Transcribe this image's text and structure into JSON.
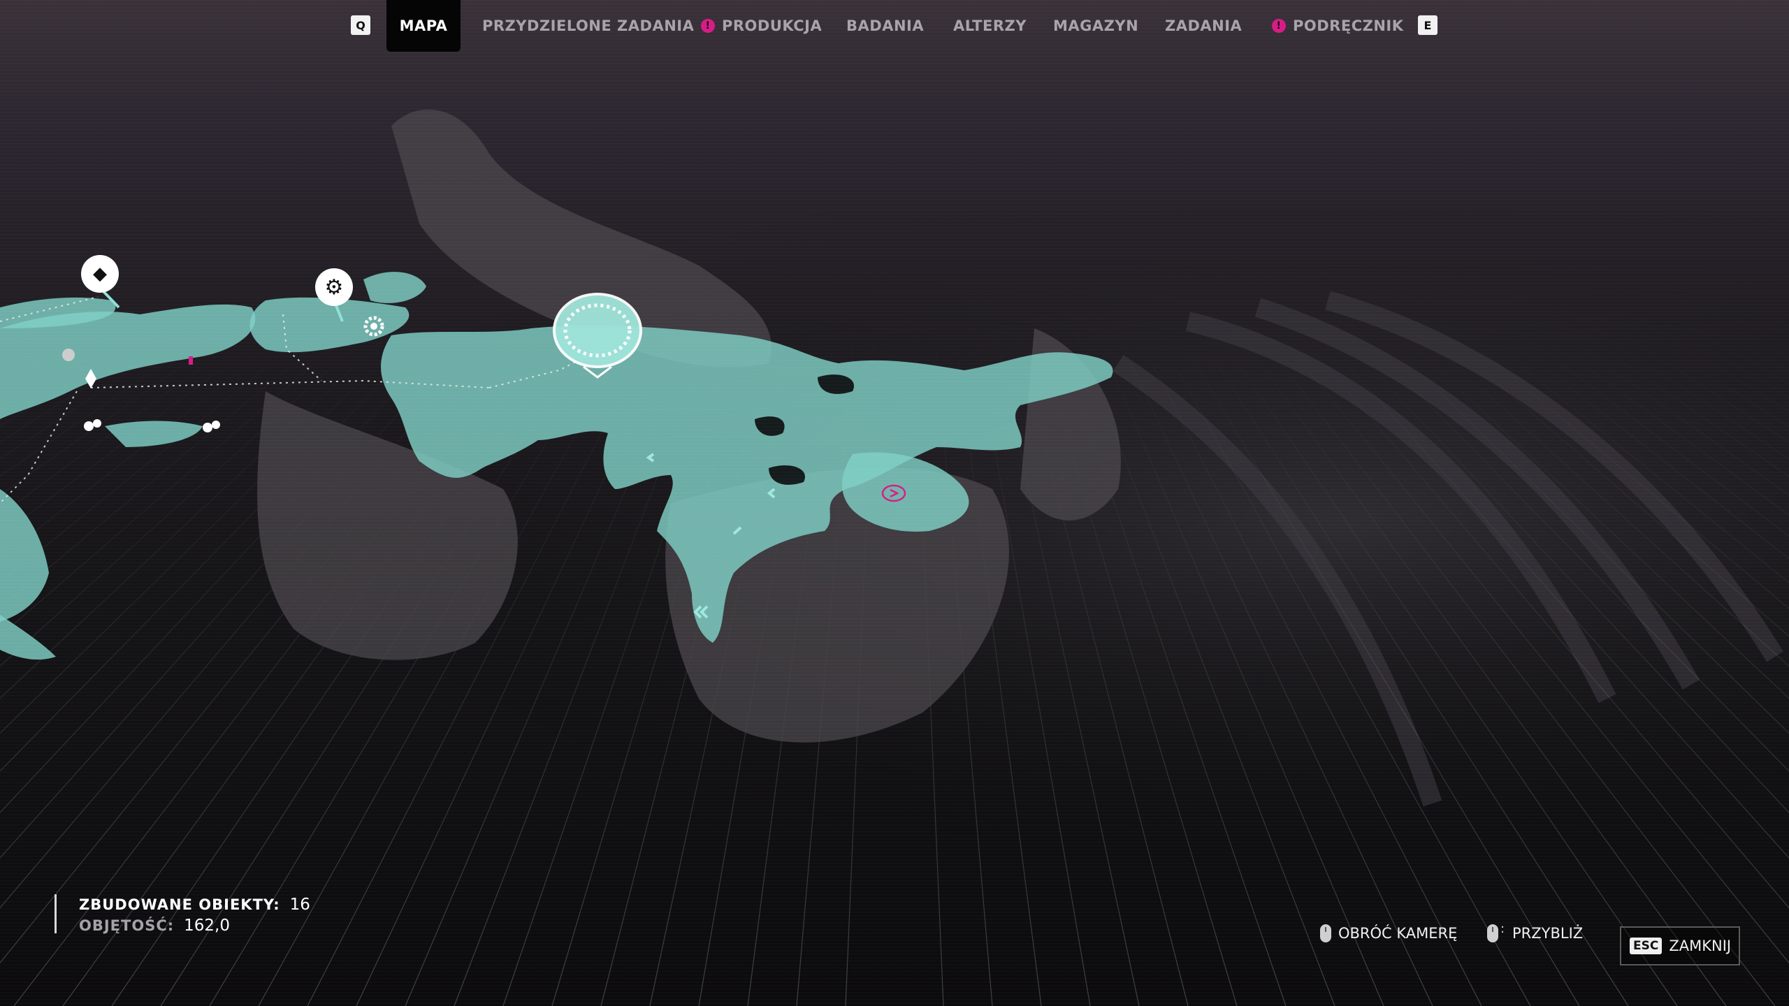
{
  "nav": {
    "left_key": "Q",
    "right_key": "E",
    "tabs": [
      {
        "label": "MAPA",
        "active": true,
        "alert": false
      },
      {
        "label": "PRZYDZIELONE ZADANIA",
        "active": false,
        "alert": false
      },
      {
        "label": "PRODUKCJA",
        "active": false,
        "alert": true
      },
      {
        "label": "BADANIA",
        "active": false,
        "alert": false
      },
      {
        "label": "ALTERZY",
        "active": false,
        "alert": false
      },
      {
        "label": "MAGAZYN",
        "active": false,
        "alert": false
      },
      {
        "label": "ZADANIA",
        "active": false,
        "alert": false
      },
      {
        "label": "PODRĘCZNIK",
        "active": false,
        "alert": true
      }
    ],
    "alert_glyph": "!",
    "alert_color": "#d61d86"
  },
  "stats": {
    "built_label": "ZBUDOWANE OBIEKTY:",
    "built_value": "16",
    "volume_label": "OBJĘTOŚĆ:",
    "volume_value": "162,0"
  },
  "hints": {
    "rotate_label": "OBRÓĆ KAMERĘ",
    "zoom_label": "PRZYBLIŻ",
    "close_key": "ESC",
    "close_label": "ZAMKNIJ"
  },
  "map": {
    "terrain_color": "#7fd0c6",
    "marker_icons": [
      "diamond-icon",
      "gear-icon",
      "base-dome-icon",
      "target-icon"
    ]
  }
}
